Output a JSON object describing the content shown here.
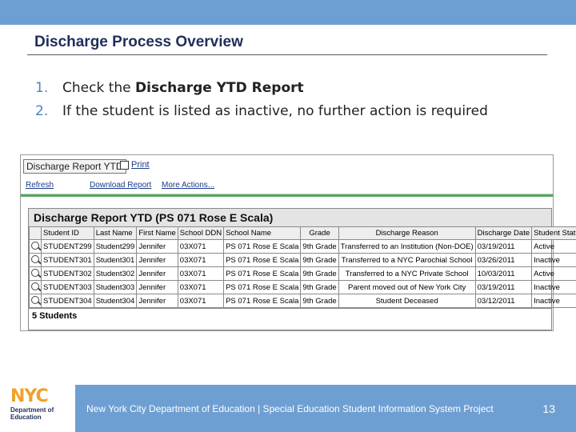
{
  "slide": {
    "title": "Discharge Process Overview",
    "bullets": [
      {
        "num": "1.",
        "text_pre": "Check the ",
        "text_bold": "Discharge YTD Report",
        "text_post": ""
      },
      {
        "num": "2.",
        "text_pre": "If the student is listed as inactive, no further action is required",
        "text_bold": "",
        "text_post": ""
      }
    ],
    "footer_text": "New York City Department of Education | Special Education Student Information System Project",
    "page_number": "13"
  },
  "logo": {
    "nyc": "NYC",
    "line1": "Department of",
    "line2": "Education"
  },
  "screenshot": {
    "tab_title": "Discharge Report YTD",
    "print_label": "Print",
    "toolbar": {
      "refresh": "Refresh",
      "download": "Download Report",
      "more": "More Actions..."
    },
    "report_heading": "Discharge Report YTD (PS 071 Rose E Scala)",
    "columns": [
      "",
      "Student ID",
      "Last Name",
      "First Name",
      "School DDN",
      "School Name",
      "Grade",
      "Discharge Reason",
      "Discharge Date",
      "Student Status"
    ],
    "rows": [
      [
        "STUDENT299",
        "Student299",
        "Jennifer",
        "03X071",
        "PS 071 Rose E Scala",
        "9th Grade",
        "Transferred to an Institution (Non-DOE)",
        "03/19/2011",
        "Active"
      ],
      [
        "STUDENT301",
        "Student301",
        "Jennifer",
        "03X071",
        "PS 071 Rose E Scala",
        "9th Grade",
        "Transferred to a NYC Parochial School",
        "03/26/2011",
        "Inactive"
      ],
      [
        "STUDENT302",
        "Student302",
        "Jennifer",
        "03X071",
        "PS 071 Rose E Scala",
        "9th Grade",
        "Transferred to a NYC Private School",
        "10/03/2011",
        "Active"
      ],
      [
        "STUDENT303",
        "Student303",
        "Jennifer",
        "03X071",
        "PS 071 Rose E Scala",
        "9th Grade",
        "Parent moved out of New York City",
        "03/19/2011",
        "Inactive"
      ],
      [
        "STUDENT304",
        "Student304",
        "Jennifer",
        "03X071",
        "PS 071 Rose E Scala",
        "9th Grade",
        "Student Deceased",
        "03/12/2011",
        "Inactive"
      ]
    ],
    "count_label": "5 Students"
  }
}
